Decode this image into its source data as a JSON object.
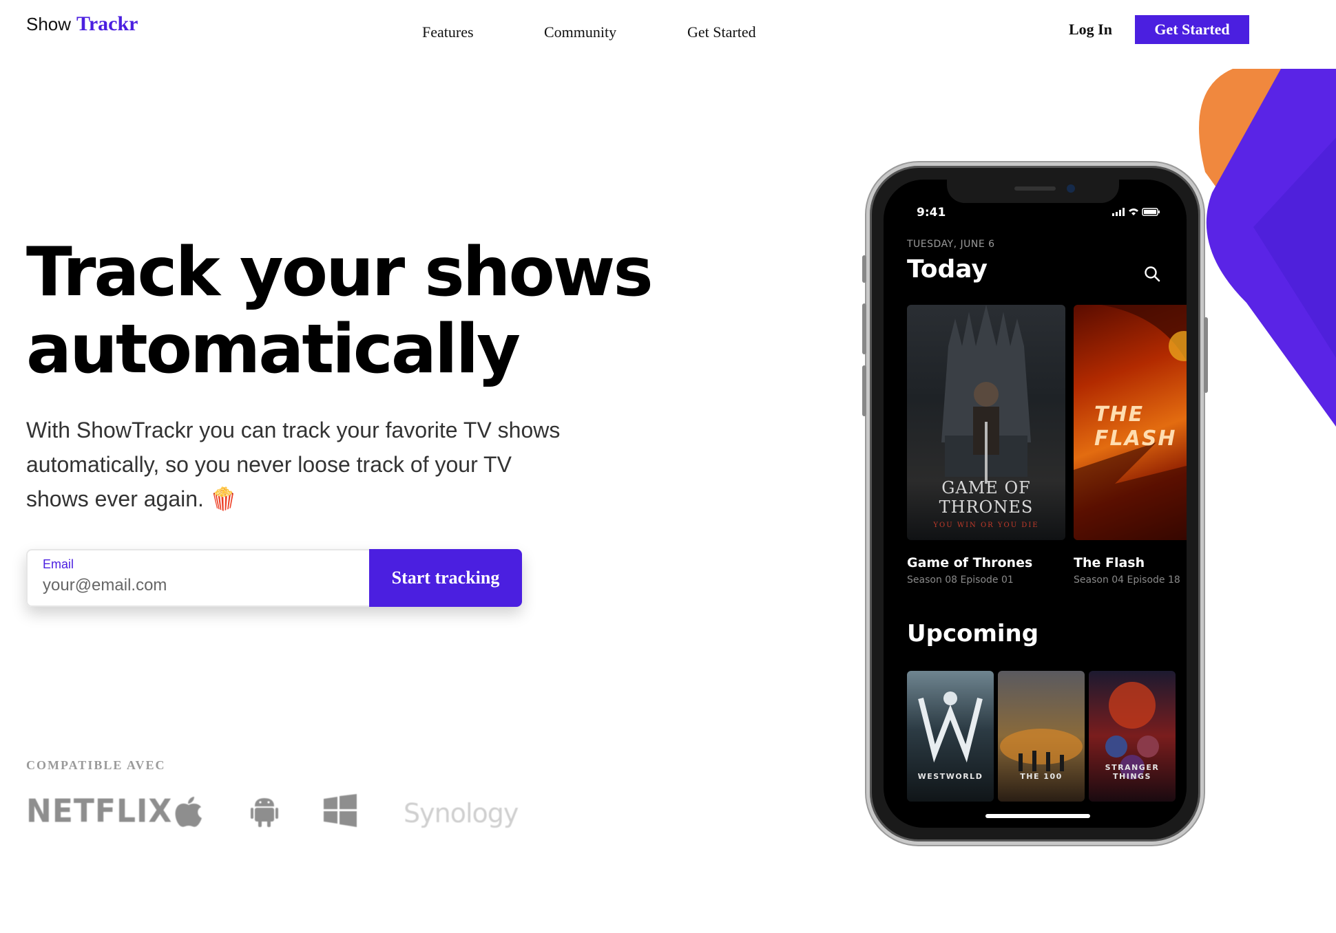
{
  "brand": {
    "show": "Show",
    "trackr": "Trackr"
  },
  "nav": {
    "features": "Features",
    "community": "Community",
    "get_started": "Get Started"
  },
  "header": {
    "login": "Log In",
    "cta": "Get Started"
  },
  "hero": {
    "title_line1": "Track your shows",
    "title_line2": "automatically",
    "subtitle": "With ShowTrackr you can track your favorite TV shows automatically, so you never loose track of your TV shows ever again. 🍿"
  },
  "form": {
    "label": "Email",
    "placeholder": "your@email.com",
    "value": "",
    "button": "Start tracking"
  },
  "compatible": {
    "label": "COMPATIBLE AVEC",
    "platforms": [
      {
        "name": "NETFLIX",
        "icon": "netflix-logo"
      },
      {
        "name": "",
        "icon": "apple-icon"
      },
      {
        "name": "",
        "icon": "android-icon"
      },
      {
        "name": "",
        "icon": "windows-icon"
      },
      {
        "name": "Synology",
        "icon": "synology-logo"
      }
    ]
  },
  "phone": {
    "status_time": "9:41",
    "date": "TUESDAY, JUNE 6",
    "today_title": "Today",
    "today_shows": [
      {
        "title": "Game of Thrones",
        "episode": "Season 08 Episode 01",
        "poster_text": "GAME OF THRONES",
        "poster_tag": "YOU WIN OR YOU DIE"
      },
      {
        "title": "The Flash",
        "episode": "Season 04 Episode 18",
        "poster_text": "THE FLASH"
      }
    ],
    "upcoming_title": "Upcoming",
    "upcoming_shows": [
      {
        "poster_text": "WESTWORLD"
      },
      {
        "poster_text": "THE 100"
      },
      {
        "poster_text": "STRANGER THINGS"
      }
    ]
  },
  "colors": {
    "accent": "#4b1fe0",
    "deco_orange": "#f0883e",
    "deco_purple": "#5a24e6"
  }
}
